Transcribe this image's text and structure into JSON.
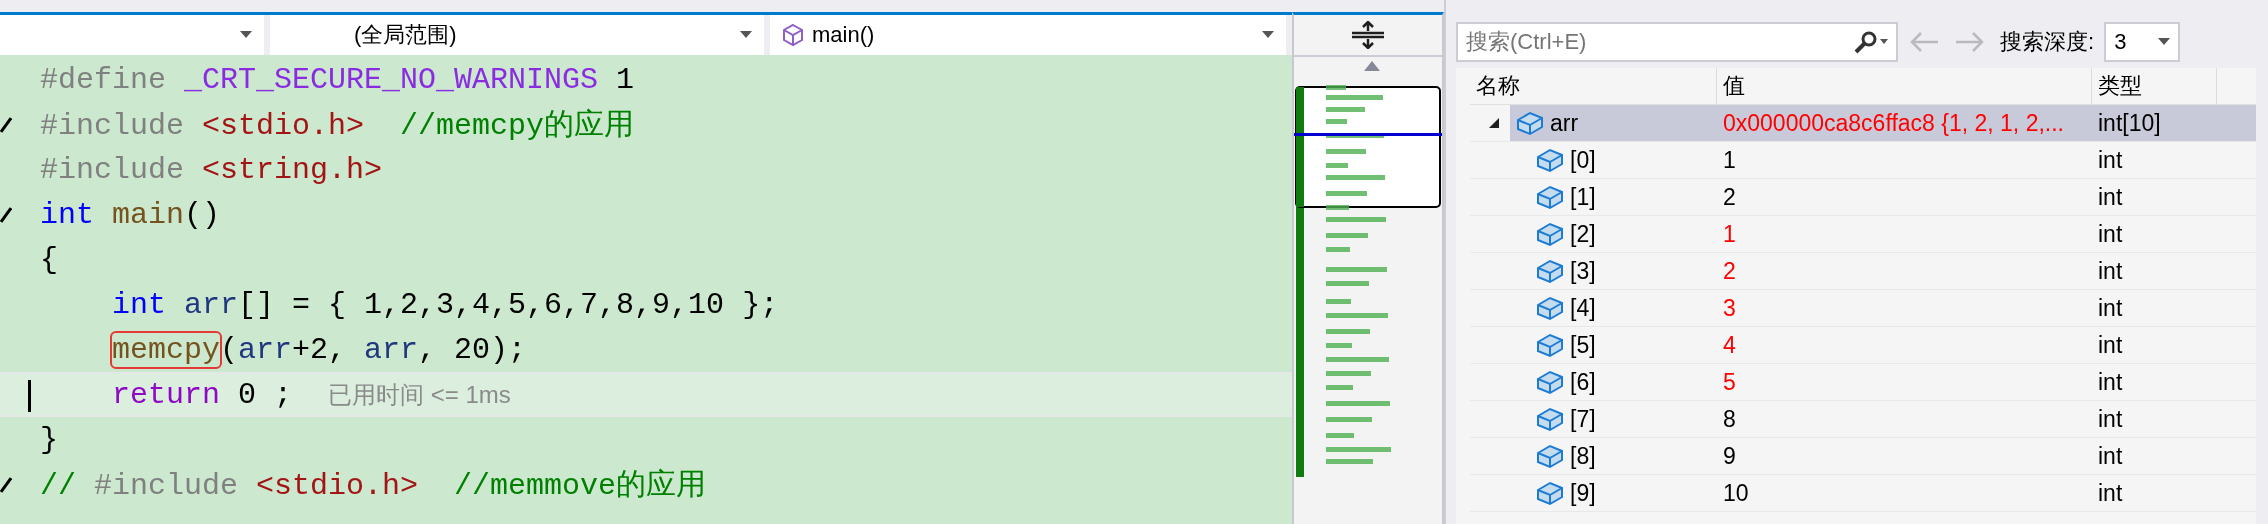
{
  "editor": {
    "dropdowns": [
      {
        "kind": "plain"
      },
      {
        "label": "(全局范围)",
        "kind": "plain"
      },
      {
        "label": "main()",
        "kind": "member"
      }
    ],
    "lines": [
      {
        "tokens": [
          {
            "text": "#define",
            "kind": "preproc"
          },
          {
            "text": " _CRT_SECURE_NO_WARNINGS",
            "kind": "macro"
          },
          {
            "text": " 1",
            "kind": "plain"
          }
        ]
      },
      {
        "marker": true,
        "tokens": [
          {
            "text": "#include",
            "kind": "preproc"
          },
          {
            "text": " <stdio.h>",
            "kind": "string"
          },
          {
            "text": "  //memcpy的应用",
            "kind": "comment"
          }
        ]
      },
      {
        "tokens": [
          {
            "text": "#include",
            "kind": "preproc"
          },
          {
            "text": " <string.h>",
            "kind": "string"
          }
        ]
      },
      {
        "marker": true,
        "tokens": [
          {
            "text": "int",
            "kind": "keyword"
          },
          {
            "text": " main",
            "kind": "func"
          },
          {
            "text": "()",
            "kind": "plain"
          }
        ]
      },
      {
        "tokens": [
          {
            "text": "{",
            "kind": "plain"
          }
        ]
      },
      {
        "tokens": [
          {
            "text": "    int",
            "kind": "keyword"
          },
          {
            "text": " arr",
            "kind": "ident"
          },
          {
            "text": "[] = { 1,2,3,4,5,6,7,8,9,10 };",
            "kind": "plain"
          }
        ]
      },
      {
        "tokens": [
          {
            "text": "memcpy",
            "kind": "func",
            "boxed": true,
            "indent": true
          },
          {
            "text": "(",
            "kind": "plain"
          },
          {
            "text": "arr",
            "kind": "ident"
          },
          {
            "text": "+2, ",
            "kind": "plain"
          },
          {
            "text": "arr",
            "kind": "ident"
          },
          {
            "text": ", 20);",
            "kind": "plain"
          }
        ]
      },
      {
        "current": true,
        "tokens": [
          {
            "text": "    return",
            "kind": "control"
          },
          {
            "text": " 0 ;",
            "kind": "plain"
          }
        ],
        "perf_tip": "已用时间 <= 1ms"
      },
      {
        "tokens": [
          {
            "text": "}",
            "kind": "plain"
          }
        ]
      },
      {
        "marker": true,
        "tokens": [
          {
            "text": "// ",
            "kind": "comment"
          },
          {
            "text": "#include",
            "kind": "preproc"
          },
          {
            "text": " <stdio.h>",
            "kind": "string"
          },
          {
            "text": "  //memmove的应用",
            "kind": "comment"
          }
        ]
      }
    ]
  },
  "watch": {
    "search": {
      "placeholder": "搜索(Ctrl+E)"
    },
    "depth_label": "搜索深度:",
    "depth": "3",
    "columns": [
      "名称",
      "值",
      "类型"
    ],
    "rows": [
      {
        "name": "arr",
        "value": "0x000000ca8c6ffac8 {1, 2, 1, 2,...",
        "type": "int[10]",
        "changed": true,
        "expanded": true,
        "selected": true,
        "children": [
          {
            "name": "[0]",
            "value": "1",
            "type": "int",
            "changed": false,
            "selected": false
          },
          {
            "name": "[1]",
            "value": "2",
            "type": "int",
            "changed": false,
            "selected": false
          },
          {
            "name": "[2]",
            "value": "1",
            "type": "int",
            "changed": true,
            "selected": false
          },
          {
            "name": "[3]",
            "value": "2",
            "type": "int",
            "changed": true,
            "selected": false
          },
          {
            "name": "[4]",
            "value": "3",
            "type": "int",
            "changed": true,
            "selected": false
          },
          {
            "name": "[5]",
            "value": "4",
            "type": "int",
            "changed": true,
            "selected": false
          },
          {
            "name": "[6]",
            "value": "5",
            "type": "int",
            "changed": true,
            "selected": false
          },
          {
            "name": "[7]",
            "value": "8",
            "type": "int",
            "changed": false,
            "selected": false
          },
          {
            "name": "[8]",
            "value": "9",
            "type": "int",
            "changed": false,
            "selected": false
          },
          {
            "name": "[9]",
            "value": "10",
            "type": "int",
            "changed": false,
            "selected": false
          }
        ]
      }
    ]
  }
}
